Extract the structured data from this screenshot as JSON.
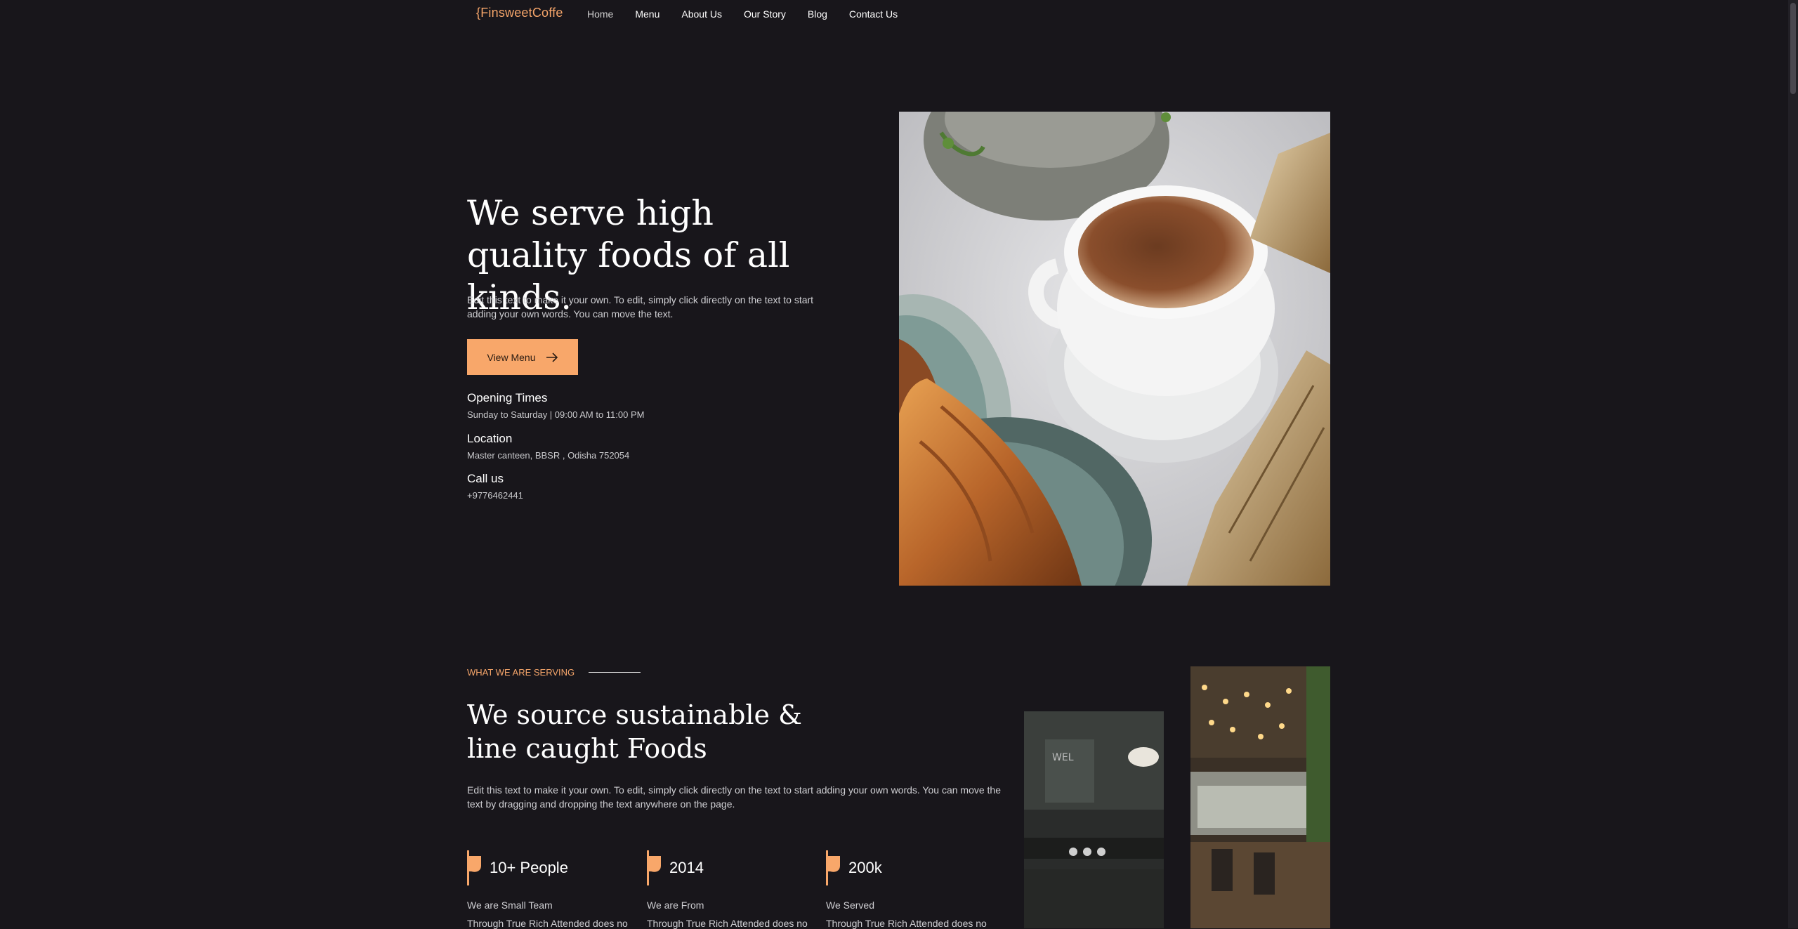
{
  "nav": {
    "logo": "{FinsweetCoffe",
    "items": [
      {
        "label": "Home"
      },
      {
        "label": "Menu"
      },
      {
        "label": "About Us"
      },
      {
        "label": "Our Story"
      },
      {
        "label": "Blog"
      },
      {
        "label": "Contact Us"
      }
    ]
  },
  "hero": {
    "title": "We serve high quality foods of all kinds.",
    "description": "Edit this text to make it your own. To edit, simply click directly on the text to start adding your own words. You can move the text.",
    "button_label": "View Menu",
    "info": [
      {
        "heading": "Opening Times",
        "text": "Sunday to Saturday | 09:00 AM to 11:00 PM"
      },
      {
        "heading": "Location",
        "text": "Master canteen, BBSR , Odisha 752054"
      },
      {
        "heading": "Call us",
        "text": "+9776462441"
      }
    ]
  },
  "serving": {
    "eyebrow": "WHAT WE ARE SERVING",
    "title": "We source sustainable & line caught Foods",
    "description": "Edit this text to make it your own. To edit, simply click directly on the text to start adding your own words. You can move the text by dragging and dropping the text anywhere on the page.",
    "stats": [
      {
        "value": "10+ People",
        "label": "We are Small Team",
        "text": "Through True Rich Attended does no"
      },
      {
        "value": "2014",
        "label": "We are From",
        "text": "Through True Rich Attended does no"
      },
      {
        "value": "200k",
        "label": "We Served",
        "text": "Through True Rich Attended does no"
      }
    ]
  },
  "colors": {
    "accent": "#f8a76a",
    "background": "#18161b"
  }
}
